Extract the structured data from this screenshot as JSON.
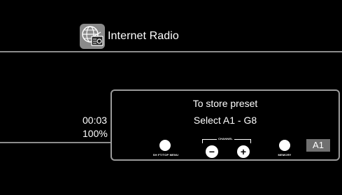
{
  "header": {
    "icon": "globe-radio-icon",
    "title": "Internet Radio"
  },
  "status": {
    "time": "00:03",
    "volume": "100%"
  },
  "popup": {
    "line1": "To store preset",
    "line2": "Select A1 - G8",
    "controls": {
      "shift_top_menu_label": "SH FT/TOP MENU",
      "channel_label": "CHANNEL",
      "channel_minus": "−",
      "channel_plus": "+",
      "memory_label": "MEMORY",
      "preset_value": "A1"
    }
  },
  "colors": {
    "background": "#000000",
    "divider": "#8c8c8c",
    "popup_border": "#9a9a9a",
    "badge": "#707070"
  }
}
